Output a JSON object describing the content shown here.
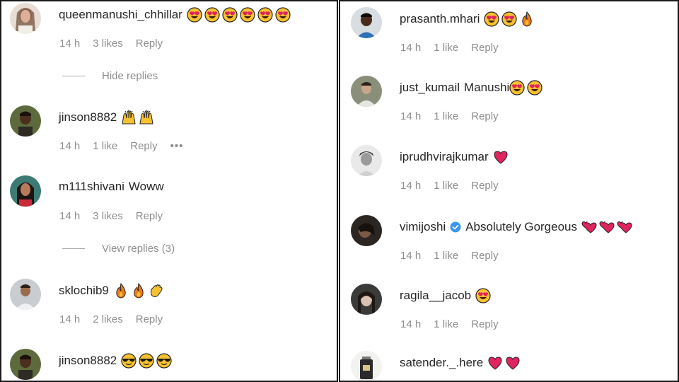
{
  "left": {
    "comments": [
      {
        "username": "queenmanushi_chhillar",
        "text": "",
        "emoji_count": 6,
        "emoji": "heart-eyes",
        "time": "14 h",
        "likes": "3 likes",
        "reply": "Reply"
      },
      {
        "username": "jinson8882",
        "text": "",
        "emoji_count": 2,
        "emoji": "raised-hands",
        "time": "14 h",
        "likes": "1 like",
        "reply": "Reply",
        "more": "•••"
      },
      {
        "username": "m111shivani",
        "text": "Woww",
        "time": "14 h",
        "likes": "3 likes",
        "reply": "Reply"
      },
      {
        "username": "sklochib9",
        "text": "",
        "emojis": [
          "fire",
          "fire",
          "clap"
        ],
        "time": "14 h",
        "likes": "2 likes",
        "reply": "Reply"
      },
      {
        "username": "jinson8882",
        "text": "",
        "emoji_count": 3,
        "emoji": "sunglasses"
      }
    ],
    "hide_replies": "Hide replies",
    "view_replies": "View replies (3)"
  },
  "right": {
    "comments": [
      {
        "username": "prasanth.mhari",
        "text": "",
        "emojis": [
          "heart-eyes",
          "heart-eyes",
          "fire"
        ],
        "time": "14 h",
        "likes": "1 like",
        "reply": "Reply"
      },
      {
        "username": "just_kumail",
        "text": "Manushi",
        "emoji_count": 2,
        "emoji": "heart-eyes",
        "time": "14 h",
        "likes": "1 like",
        "reply": "Reply"
      },
      {
        "username": "iprudhvirajkumar",
        "text": "",
        "emoji_count": 1,
        "emoji": "red-heart",
        "time": "14 h",
        "likes": "1 like",
        "reply": "Reply"
      },
      {
        "username": "vimijoshi",
        "verified": true,
        "text": "Absolutely Gorgeous",
        "emoji_count": 3,
        "emoji": "revolving-hearts",
        "time": "14 h",
        "likes": "1 like",
        "reply": "Reply"
      },
      {
        "username": "ragila__jacob",
        "text": "",
        "emoji_count": 1,
        "emoji": "heart-eyes",
        "time": "14 h",
        "likes": "1 like",
        "reply": "Reply"
      },
      {
        "username": "satender._.here",
        "text": "",
        "emoji_count": 2,
        "emoji": "red-heart"
      }
    ]
  },
  "colors": {
    "text": "#262626",
    "meta": "#8e8e8e",
    "verified": "#3897f0",
    "heart": "#e0245e",
    "emoji_face": "#f7c22f"
  }
}
